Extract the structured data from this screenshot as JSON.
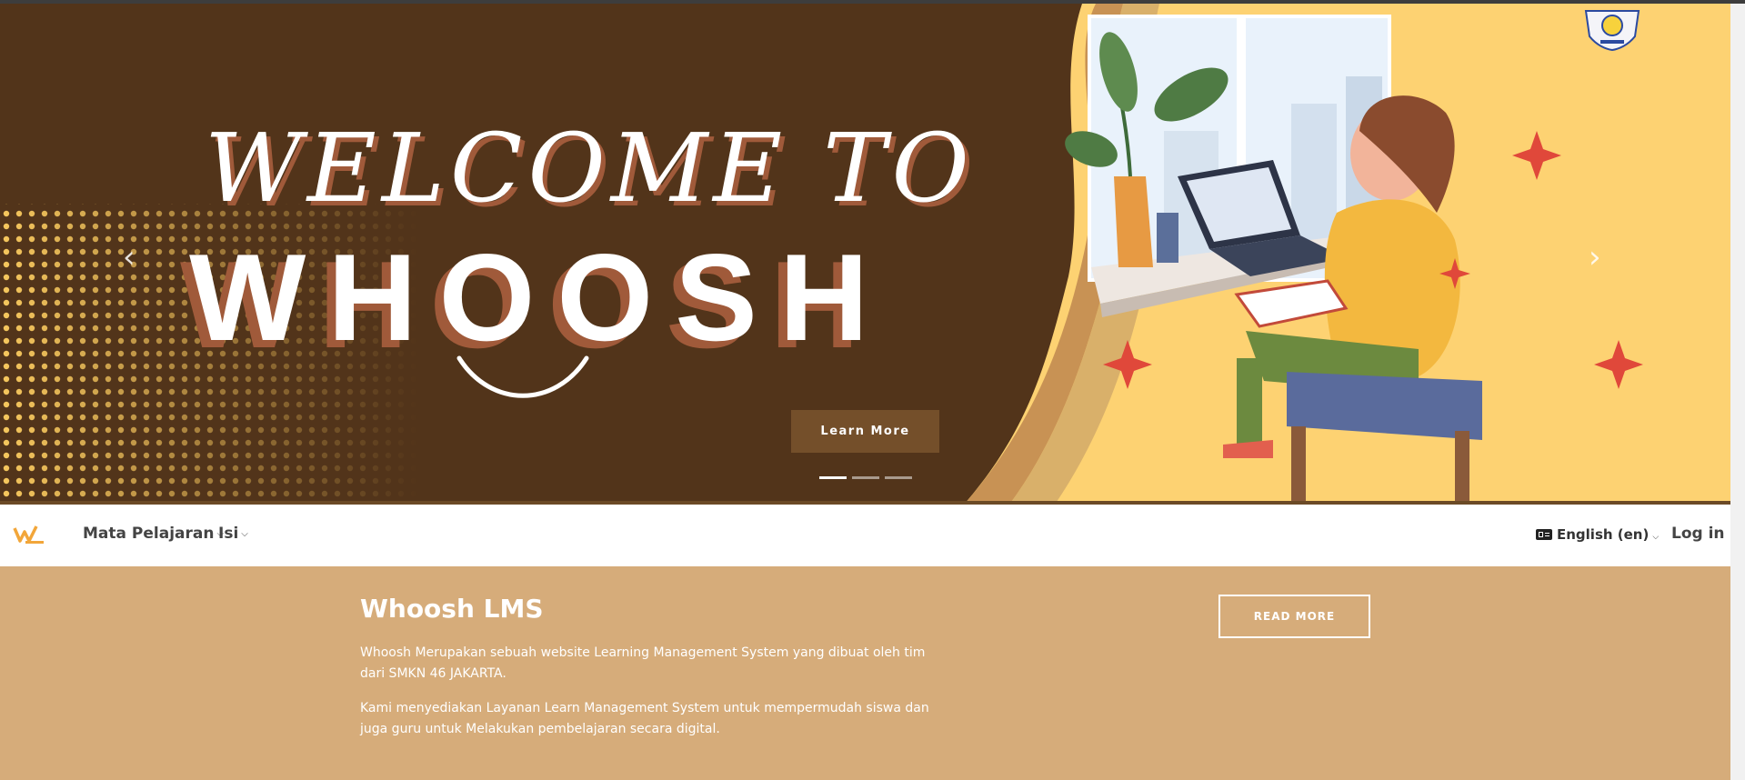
{
  "hero": {
    "welcome_text": "WELCOME TO",
    "brand_text": "WHOOSH",
    "learn_more_label": "Learn More",
    "prev_icon": "‹",
    "next_icon": "›",
    "slides_count": 3,
    "active_slide": 1
  },
  "navbar": {
    "menu_courses": "Mata Pelajaran",
    "menu_content": "Isi",
    "language": "English (en)",
    "login": "Log in"
  },
  "info": {
    "title": "Whoosh LMS",
    "paragraph1": "Whoosh Merupakan sebuah website Learning Management System yang dibuat oleh tim dari SMKN 46 JAKARTA.",
    "paragraph2": "Kami menyediakan Layanan Learn Management System untuk mempermudah siswa dan juga guru untuk Melakukan pembelajaran secara digital.",
    "read_more": "READ MORE"
  },
  "colors": {
    "hero_bg": "#52341a",
    "hero_right_bg": "#fdd272",
    "button_bg": "#744f2a",
    "info_bg": "#d6ac7a"
  }
}
